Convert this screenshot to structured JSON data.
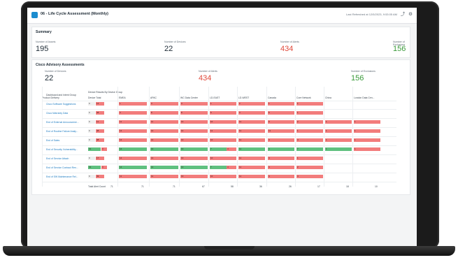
{
  "window": {
    "title": "06 - Life Cycle Assessment (Monthly)",
    "last_refreshed": "Last Refreshed at 12/5/2023, 9:53:05 AM"
  },
  "summary": {
    "title": "Summary",
    "items": [
      {
        "label": "Number of Assets",
        "value": "195"
      },
      {
        "label": "Number of Devices",
        "value": "22"
      },
      {
        "label": "Number of Alerts",
        "value": "434"
      },
      {
        "label": "Number of Exclusions",
        "value": "156"
      }
    ]
  },
  "advisory": {
    "title": "Cisco Advisory Assessments",
    "items": [
      {
        "label": "Number of Devices",
        "value": "22"
      },
      {
        "label": "Number of Alerts",
        "value": "434"
      },
      {
        "label": "Number of Exclusions",
        "value": "156"
      }
    ]
  },
  "table": {
    "left_header": "Dashboard and Intent Group",
    "group_header": "Device Results By Device Group",
    "columns": [
      "Device Total",
      "EMEA",
      "APAC",
      "WC Data Center",
      "LD-EAST",
      "LD-WEST",
      "Canada",
      "Core Network",
      "China",
      "London Data Cen...",
      "Product Delivery"
    ],
    "rows": [
      {
        "label": "Cisco Software Suggestions",
        "cells": [
          [
            "0",
            "14"
          ],
          [
            "1"
          ],
          [
            "3"
          ],
          [
            "3"
          ],
          [
            "1"
          ],
          [
            "2"
          ],
          [
            "1"
          ],
          [
            "1"
          ],
          [],
          []
        ]
      },
      {
        "label": "Cisco Warranty Data",
        "cells": [
          [
            "0",
            "48"
          ],
          [
            "3"
          ],
          [
            "8"
          ],
          [
            "8"
          ],
          [
            "5"
          ],
          [
            "3"
          ],
          [
            "5"
          ],
          [
            "1"
          ],
          [],
          []
        ]
      },
      {
        "label": "End of External Announceme...",
        "cells": [
          [
            "0",
            "11"
          ],
          [
            "11"
          ],
          [
            "11"
          ],
          [
            "13"
          ],
          [
            "10"
          ],
          [
            "11"
          ],
          [
            "9"
          ],
          [
            "2"
          ],
          [
            "1"
          ],
          [
            "1"
          ]
        ]
      },
      {
        "label": "End of Routine Failure Analy...",
        "cells": [
          [
            "0",
            "48"
          ],
          [
            "14"
          ],
          [
            "14"
          ],
          [
            "14"
          ],
          [
            "11"
          ],
          [
            "11"
          ],
          [
            "11"
          ],
          [
            "1"
          ],
          [
            "1"
          ],
          [
            "1"
          ]
        ]
      },
      {
        "label": "End of Sales",
        "cells": [
          [
            "0",
            "48"
          ],
          [
            "14"
          ],
          [
            "14"
          ],
          [
            "13"
          ],
          [
            "10"
          ],
          [
            "11"
          ],
          [
            "4"
          ],
          [
            "4"
          ],
          [
            "1"
          ],
          [
            "1"
          ]
        ]
      },
      {
        "label": "End of Security Vulnerability...",
        "cells": [
          [
            "31",
            "3"
          ],
          [
            "14"
          ],
          [
            "14"
          ],
          [
            "13"
          ],
          [
            "7",
            "4"
          ],
          [
            "11"
          ],
          [
            "4"
          ],
          [
            "7"
          ],
          [
            "1"
          ],
          [
            "1"
          ]
        ]
      },
      {
        "label": "End of Service Attach",
        "cells": [
          [
            "0",
            "17"
          ],
          [
            "14"
          ],
          [
            "14"
          ],
          [
            "13"
          ],
          [
            "10"
          ],
          [
            "11"
          ],
          [
            "4"
          ],
          [
            "1"
          ],
          [],
          []
        ]
      },
      {
        "label": "End of Service Contract Ren...",
        "cells": [
          [
            "31",
            "3"
          ],
          [
            "14"
          ],
          [
            "14"
          ],
          [
            "13"
          ],
          [
            "7",
            "4"
          ],
          [
            "11"
          ],
          [
            "4"
          ],
          [
            "2"
          ],
          [],
          []
        ]
      },
      {
        "label": "End of SW Maintenance Rel...",
        "cells": [
          [
            "0",
            "49"
          ],
          [
            "11"
          ],
          [
            "11"
          ],
          [
            "13"
          ],
          [
            "10"
          ],
          [
            "11"
          ],
          [
            "4"
          ],
          [
            "4"
          ],
          [],
          []
        ]
      }
    ],
    "totals_label": "Total Alert Count",
    "totals": [
      "71",
      "71",
      "71",
      "67",
      "58",
      "36",
      "26",
      "17",
      "18",
      "10"
    ]
  },
  "colors": {
    "alert": "#f27c7c",
    "ok": "#5fc07f",
    "link": "#1b7ac0"
  }
}
